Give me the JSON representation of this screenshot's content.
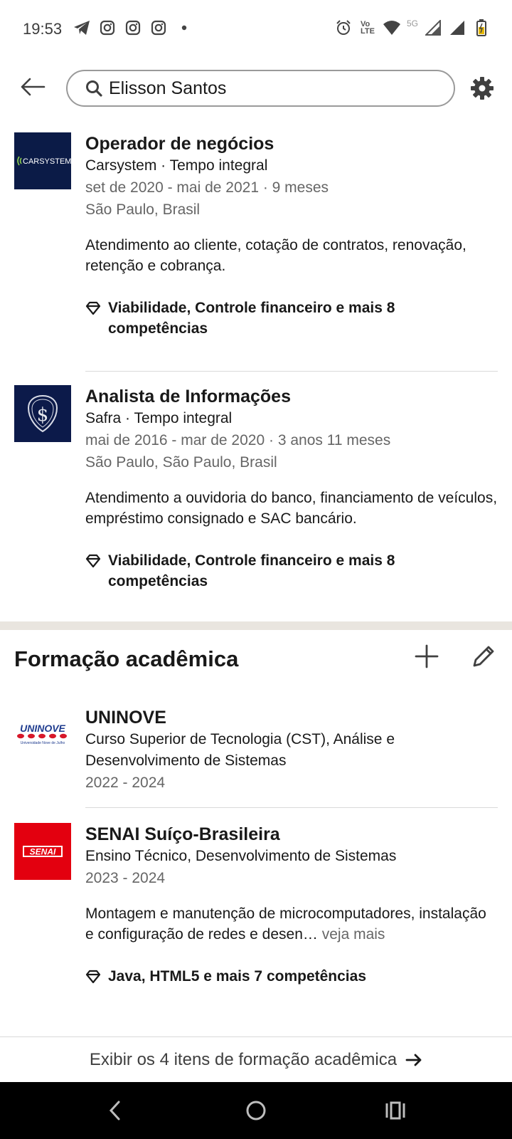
{
  "status_bar": {
    "time": "19:53",
    "left_icons": [
      "telegram-icon",
      "instagram-icon",
      "instagram-icon",
      "instagram-icon",
      "dot-icon"
    ],
    "volte_label": "Vo¹⁾ LTE",
    "network_label": "5G"
  },
  "header": {
    "search_value": "Elisson Santos"
  },
  "experience": [
    {
      "title": "Operador de negócios",
      "company": "Carsystem · Tempo integral",
      "dates": "set de 2020 - mai de 2021 · 9 meses",
      "location": "São Paulo, Brasil",
      "description": "Atendimento ao cliente, cotação de contratos, renovação, retenção e cobrança.",
      "skills": "Viabilidade, Controle financeiro e mais 8 competências",
      "logo_text": "CARSYSTEM",
      "logo_bg": "#0b1b47"
    },
    {
      "title": "Analista de Informações",
      "company": "Safra · Tempo integral",
      "dates": "mai de 2016 - mar de 2020 · 3 anos 11 meses",
      "location": "São Paulo, São Paulo, Brasil",
      "description": "Atendimento a ouvidoria do banco, financiamento de veículos, empréstimo consignado e SAC bancário.",
      "skills": "Viabilidade, Controle financeiro e mais 8 competências",
      "logo_bg": "#0c1a4a"
    }
  ],
  "education": {
    "section_title": "Formação acadêmica",
    "items": [
      {
        "school": "UNINOVE",
        "degree": "Curso Superior de Tecnologia (CST), Análise e Desenvolvimento de Sistemas",
        "years": "2022 - 2024",
        "logo_text": "UNINOVE",
        "logo_subtext": "Universidade Nove de Julho"
      },
      {
        "school": "SENAI Suíço-Brasileira",
        "degree": "Ensino Técnico, Desenvolvimento de Sistemas",
        "years": "2023 - 2024",
        "description": "Montagem e manutenção de microcomputadores, instalação e configuração de redes e desen…",
        "see_more": "veja mais",
        "skills": "Java, HTML5 e mais 7 competências",
        "logo_text": "SENAI",
        "logo_bg": "#e3000f"
      }
    ],
    "show_all_label": "Exibir os 4 itens de formação acadêmica"
  },
  "colors": {
    "text_primary": "#191919",
    "text_secondary": "#666666",
    "divider": "#d9d9d9",
    "section_gap": "#e9e5df",
    "uninove_blue": "#1f3c8f",
    "uninove_red": "#d7182a",
    "senai_red": "#e3000f"
  }
}
